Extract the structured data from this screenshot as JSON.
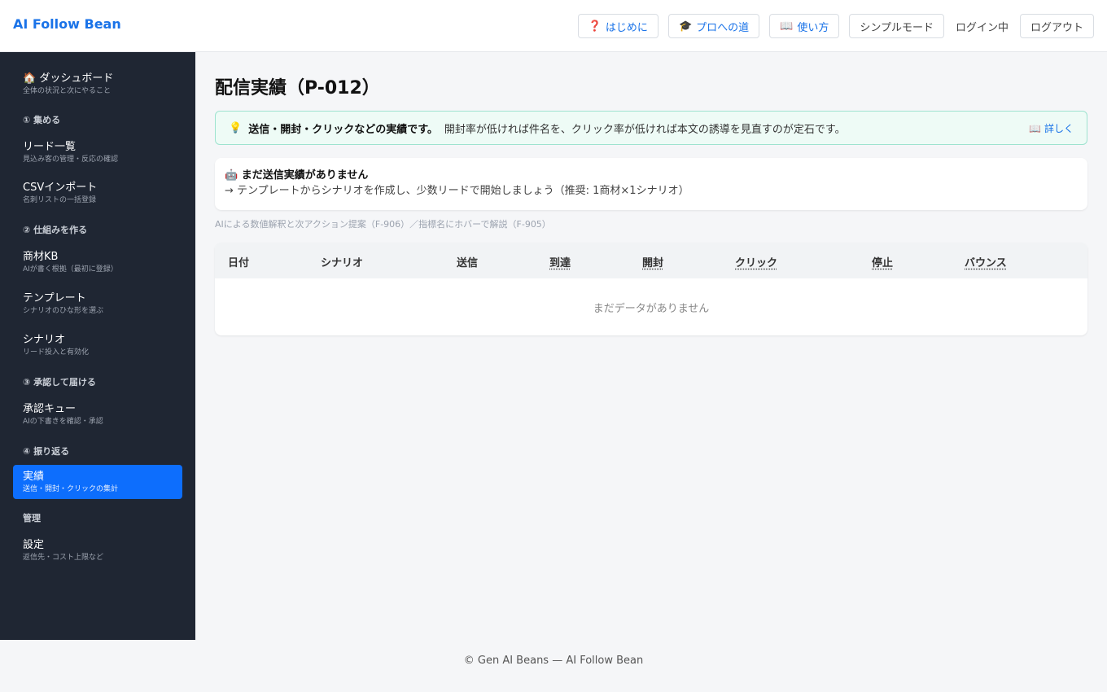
{
  "header": {
    "brand": "AI Follow Bean",
    "buttons": [
      {
        "icon": "❓",
        "label": "はじめに"
      },
      {
        "icon": "🎓",
        "label": "プロへの道"
      },
      {
        "icon": "📖",
        "label": "使い方"
      }
    ],
    "simple_mode": "シンプルモード",
    "status": "ログイン中",
    "logout": "ログアウト"
  },
  "sidebar": {
    "dashboard": {
      "icon": "🏠",
      "label": "ダッシュボード",
      "sub": "全体の状況と次にやること"
    },
    "sections": [
      "① 集める",
      "② 仕組みを作る",
      "③ 承認して届ける",
      "④ 振り返る",
      "管理"
    ],
    "items": [
      {
        "label": "リード一覧",
        "sub": "見込み客の管理・反応の確認"
      },
      {
        "label": "CSVインポート",
        "sub": "名刺リストの一括登録"
      },
      {
        "label": "商材KB",
        "sub": "AIが書く根拠（最初に登録）"
      },
      {
        "label": "テンプレート",
        "sub": "シナリオのひな形を選ぶ"
      },
      {
        "label": "シナリオ",
        "sub": "リード投入と有効化"
      },
      {
        "label": "承認キュー",
        "sub": "AIの下書きを確認・承認"
      },
      {
        "label": "実績",
        "sub": "送信・開封・クリックの集計"
      },
      {
        "label": "設定",
        "sub": "返信先・コスト上限など"
      }
    ]
  },
  "main": {
    "title": "配信実績（P-012）",
    "tip": {
      "icon": "💡",
      "strong": "送信・開封・クリックなどの実績です。",
      "rest": "開封率が低ければ件名を、クリック率が低ければ本文の誘導を見直すのが定石です。",
      "detail": "📖 詳しく"
    },
    "notice": {
      "icon": "🤖",
      "title": "まだ送信実績がありません",
      "sub": "→ テンプレートからシナリオを作成し、少数リードで開始しましょう（推奨: 1商材×1シナリオ）"
    },
    "ai_note": "AIによる数値解釈と次アクション提案（F-906）／指標名にホバーで解説（F-905）",
    "table": {
      "columns": [
        "日付",
        "シナリオ",
        "送信",
        "到達",
        "開封",
        "クリック",
        "停止",
        "バウンス"
      ],
      "rows": [],
      "empty": "まだデータがありません"
    }
  },
  "footer": "© Gen AI Beans — AI Follow Bean"
}
